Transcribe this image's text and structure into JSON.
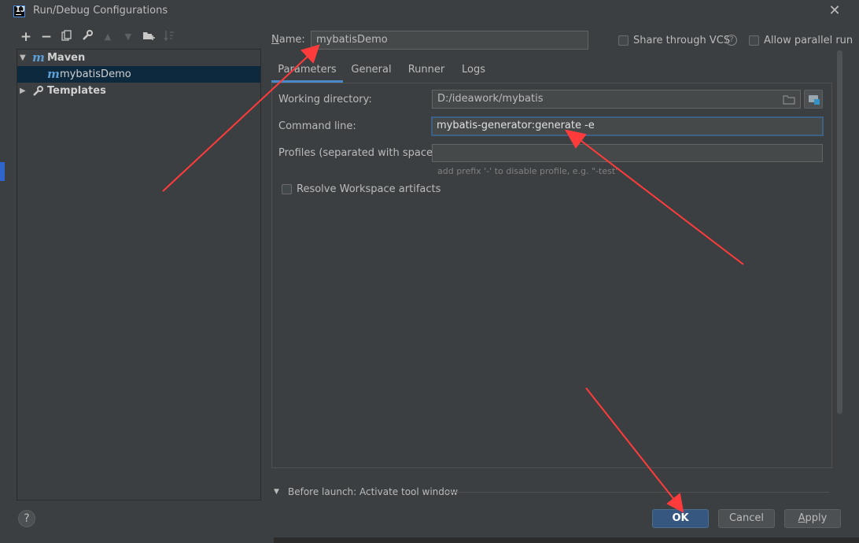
{
  "window": {
    "title": "Run/Debug Configurations"
  },
  "toolbar": {
    "add": "+",
    "remove": "−"
  },
  "tree": {
    "items": [
      {
        "label": "Maven"
      },
      {
        "label": "mybatisDemo"
      },
      {
        "label": "Templates"
      }
    ]
  },
  "name_field": {
    "label": "Name:",
    "value": "mybatisDemo"
  },
  "options": {
    "share_vcs": "Share through VCS",
    "parallel": "Allow parallel run"
  },
  "tabs": [
    {
      "label": "Parameters"
    },
    {
      "label": "General"
    },
    {
      "label": "Runner"
    },
    {
      "label": "Logs"
    }
  ],
  "params": {
    "working_dir_label": "Working directory:",
    "working_dir_value": "D:/ideawork/mybatis",
    "cmd_label": "Command line:",
    "cmd_value": "mybatis-generator:generate -e",
    "profiles_label": "Profiles (separated with space):",
    "profiles_value": "",
    "profiles_hint": "add prefix '-' to disable profile, e.g. \"-test\"",
    "resolve_label": "Resolve Workspace artifacts"
  },
  "before_launch": {
    "label": "Before launch: Activate tool window"
  },
  "buttons": {
    "ok": "OK",
    "cancel": "Cancel",
    "apply": "Apply",
    "help": "?"
  },
  "colors": {
    "background": "#3c3f41",
    "selection": "#0d293e",
    "accent": "#4a88c7",
    "primary_button": "#365880",
    "annotation_arrow": "#ff3b3b"
  }
}
